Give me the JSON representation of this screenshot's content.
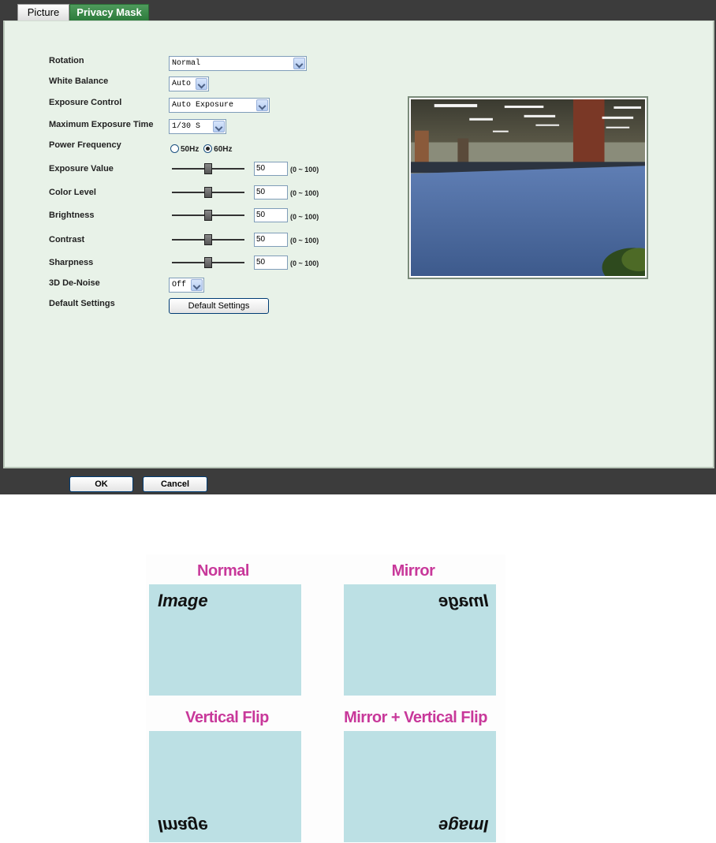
{
  "tabs": [
    {
      "label": "Picture",
      "active": false
    },
    {
      "label": "Privacy Mask",
      "active": true
    }
  ],
  "settings": {
    "rotation": {
      "label": "Rotation",
      "value": "Normal"
    },
    "white_balance": {
      "label": "White Balance",
      "value": "Auto"
    },
    "exposure_control": {
      "label": "Exposure Control",
      "value": "Auto Exposure"
    },
    "max_exposure_time": {
      "label": "Maximum Exposure Time",
      "value": "1/30 S"
    },
    "power_frequency": {
      "label": "Power Frequency",
      "options": [
        "50Hz",
        "60Hz"
      ],
      "selected": "60Hz"
    },
    "sliders": [
      {
        "label": "Exposure Value",
        "value": "50",
        "range": "(0 ~ 100)"
      },
      {
        "label": "Color Level",
        "value": "50",
        "range": "(0 ~ 100)"
      },
      {
        "label": "Brightness",
        "value": "50",
        "range": "(0 ~ 100)"
      },
      {
        "label": "Contrast",
        "value": "50",
        "range": "(0 ~ 100)"
      },
      {
        "label": "Sharpness",
        "value": "50",
        "range": "(0 ~ 100)"
      }
    ],
    "de_noise": {
      "label": "3D De-Noise",
      "value": "Off"
    },
    "default_settings": {
      "label": "Default Settings",
      "button": "Default Settings"
    }
  },
  "footer": {
    "ok": "OK",
    "cancel": "Cancel"
  },
  "diagram": {
    "word": "Image",
    "normal": "Normal",
    "mirror": "Mirror",
    "vertical_flip": "Vertical Flip",
    "mirror_vertical_flip": "Mirror + Vertical Flip",
    "title_color": "#c8389a",
    "box_color": "#bce0e4"
  },
  "colors": {
    "active_tab": "#2d7b3c",
    "panel_bg": "#e8f2e8",
    "frame": "#3c3c3c"
  }
}
